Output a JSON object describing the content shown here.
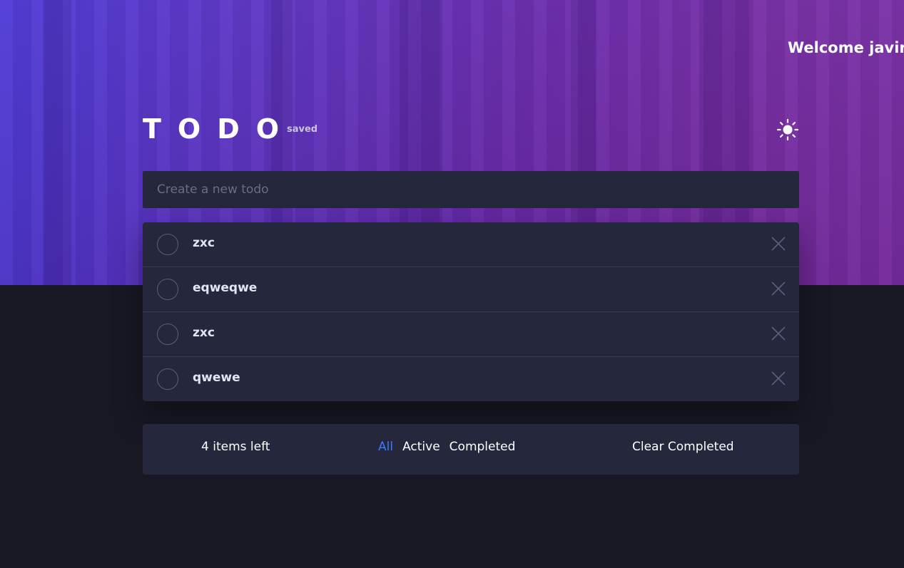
{
  "header": {
    "welcome_text": "Welcome javin",
    "title": "TODO",
    "save_status": "saved",
    "theme_icon": "sun-icon"
  },
  "new_todo": {
    "placeholder": "Create a new todo",
    "value": ""
  },
  "todos": [
    {
      "text": "zxc",
      "completed": false
    },
    {
      "text": "eqweqwe",
      "completed": false
    },
    {
      "text": "zxc",
      "completed": false
    },
    {
      "text": "qwewe",
      "completed": false
    }
  ],
  "footer": {
    "items_left": "4 items left",
    "filters": [
      {
        "label": "All",
        "active": true
      },
      {
        "label": "Active",
        "active": false
      },
      {
        "label": "Completed",
        "active": false
      }
    ],
    "clear_label": "Clear Completed"
  },
  "colors": {
    "accent": "#3a7bfd",
    "background": "#181824",
    "card": "#25273c"
  }
}
